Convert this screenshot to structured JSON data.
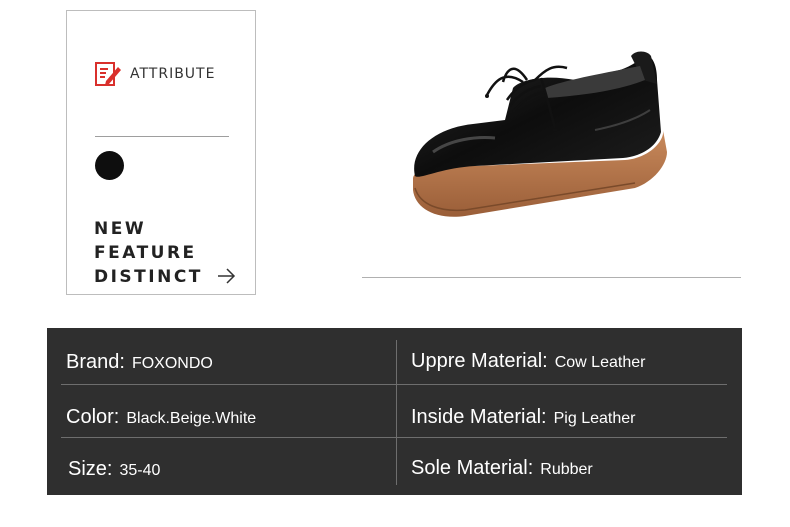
{
  "attribute_card": {
    "heading": "ATTRIBUTE",
    "swatch_color": "#0e0e0e",
    "feature_lines": [
      "NEW",
      "FEATURE",
      "DISTINCT"
    ]
  },
  "product": {
    "image_alt": "black leather oxford shoe with gum sole"
  },
  "specs": {
    "brand": {
      "label": "Brand:",
      "value": "FOXONDO"
    },
    "upper_material": {
      "label": "Uppre Material:",
      "value": "Cow Leather"
    },
    "color": {
      "label": "Color:",
      "value": "Black.Beige.White"
    },
    "inside_material": {
      "label": "Inside Material:",
      "value": "Pig Leather"
    },
    "size": {
      "label": "Size:",
      "value": "35-40"
    },
    "sole_material": {
      "label": "Sole Material:",
      "value": "Rubber"
    }
  }
}
